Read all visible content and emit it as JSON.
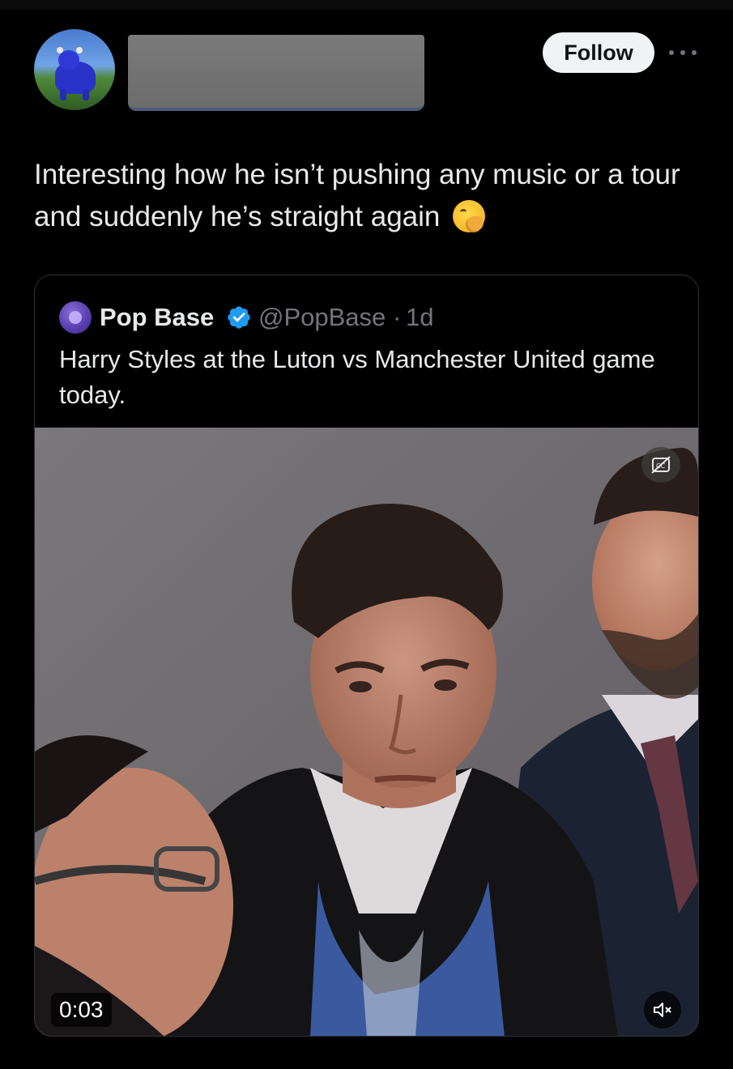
{
  "post": {
    "follow_label": "Follow",
    "text": "Interesting how he isn’t pushing any music or a tour and suddenly he’s straight again",
    "emoji_icon": "face-with-hand-over-mouth-emoji"
  },
  "quoted": {
    "name": "Pop Base",
    "handle": "@PopBase",
    "separator": "·",
    "time": "1d",
    "text": "Harry Styles at the Luton vs Manchester United game today.",
    "verified_color": "#1d9bf0"
  },
  "video": {
    "timestamp": "0:03",
    "captions_icon": "captions-off-icon",
    "mute_icon": "volume-muted-icon"
  },
  "colors": {
    "background": "#000000",
    "text": "#e7e9ea",
    "muted_text": "#71767b",
    "border": "#2f3336"
  }
}
